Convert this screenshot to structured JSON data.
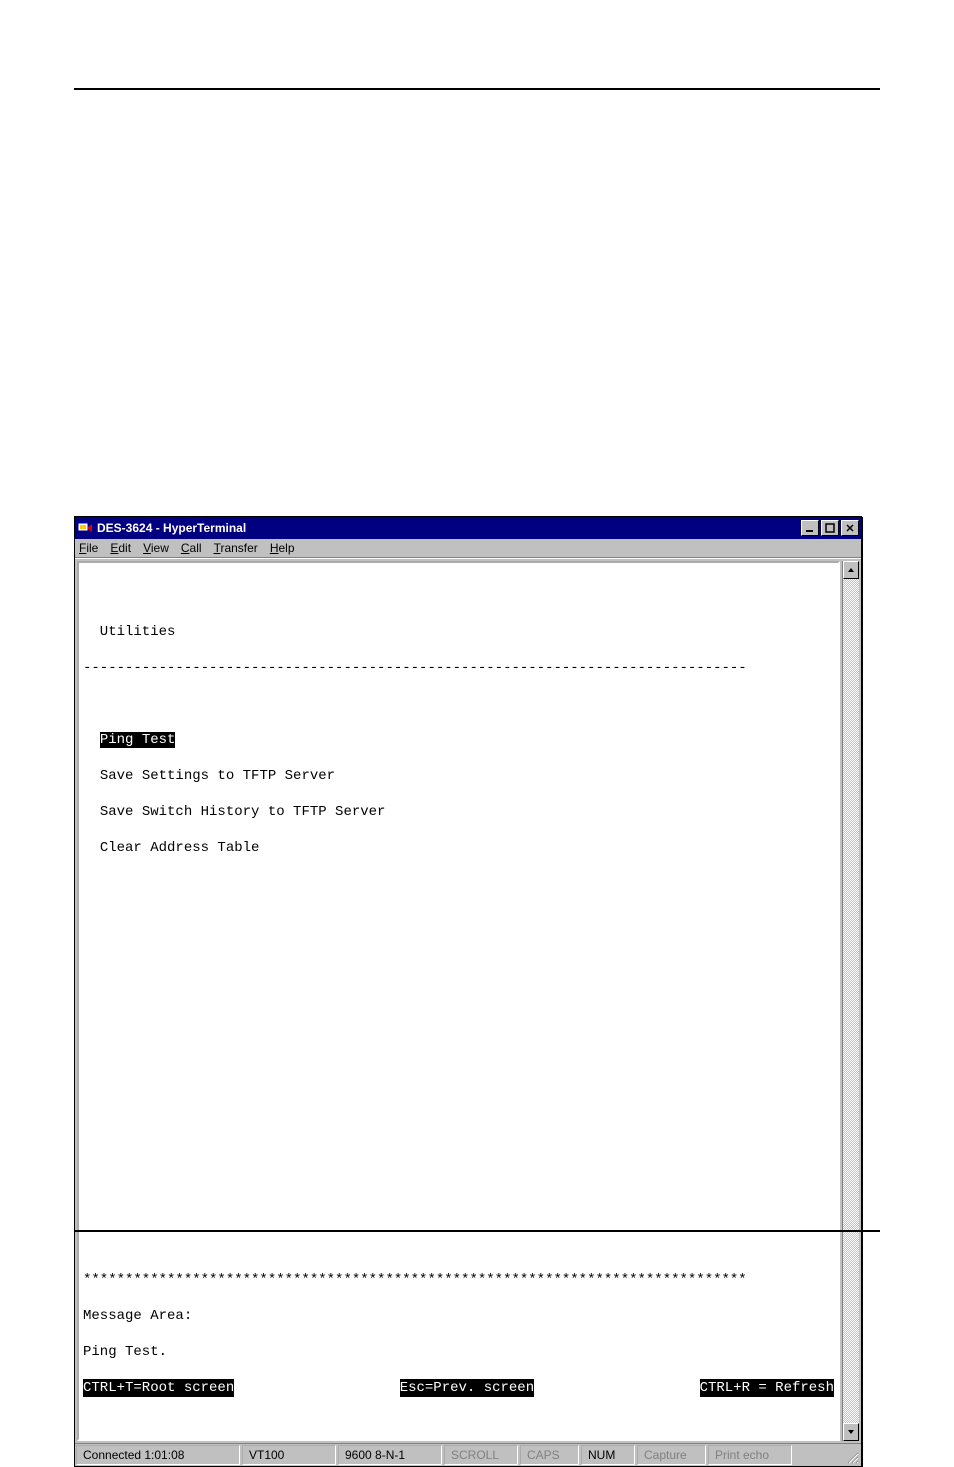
{
  "window": {
    "title": "DES-3624 - HyperTerminal",
    "buttons": {
      "min": "_",
      "max": "□",
      "close": "×"
    }
  },
  "menubar": {
    "items": [
      {
        "hot": "F",
        "rest": "ile"
      },
      {
        "hot": "E",
        "rest": "dit"
      },
      {
        "hot": "V",
        "rest": "iew"
      },
      {
        "hot": "C",
        "rest": "all"
      },
      {
        "hot": "T",
        "rest": "ransfer"
      },
      {
        "hot": "H",
        "rest": "elp"
      }
    ]
  },
  "terminal": {
    "heading": "  Utilities",
    "rule": "-------------------------------------------------------------------------------",
    "menu": {
      "selected": "Ping Test",
      "items": [
        "Save Settings to TFTP Server",
        "Save Switch History to TFTP Server",
        "Clear Address Table"
      ]
    },
    "stars": "*******************************************************************************",
    "msg_label": "Message Area:",
    "msg_text": "Ping Test.",
    "hints": {
      "left": "CTRL+T=Root screen",
      "center": "Esc=Prev. screen",
      "right": "CTRL+R = Refresh"
    }
  },
  "statusbar": {
    "connected": "Connected 1:01:08",
    "emulation": "VT100",
    "settings": "9600 8-N-1",
    "scroll": "SCROLL",
    "caps": "CAPS",
    "num": "NUM",
    "capture": "Capture",
    "printecho": "Print echo"
  }
}
